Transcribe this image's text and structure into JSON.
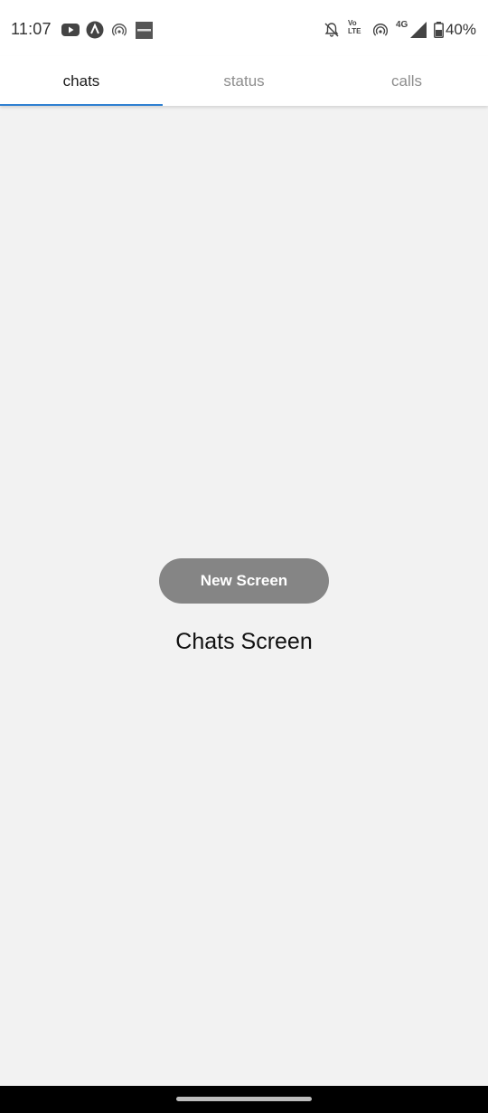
{
  "status_bar": {
    "time": "11:07",
    "battery_percent": "40%",
    "network": "4G",
    "volte_top": "Vo",
    "volte_bottom": "LTE",
    "left_icons": [
      "youtube-icon",
      "app-a-icon",
      "hotspot-icon",
      "app-square-icon"
    ],
    "right_icons": [
      "bell-off-icon",
      "volte-icon",
      "hotspot-icon",
      "signal-icon",
      "battery-icon"
    ]
  },
  "tabs": [
    {
      "label": "chats",
      "active": true
    },
    {
      "label": "status",
      "active": false
    },
    {
      "label": "calls",
      "active": false
    }
  ],
  "colors": {
    "tab_indicator": "#2f80d1",
    "button_bg": "#858585",
    "background": "#f2f2f2"
  },
  "main": {
    "button_label": "New Screen",
    "title": "Chats Screen"
  }
}
